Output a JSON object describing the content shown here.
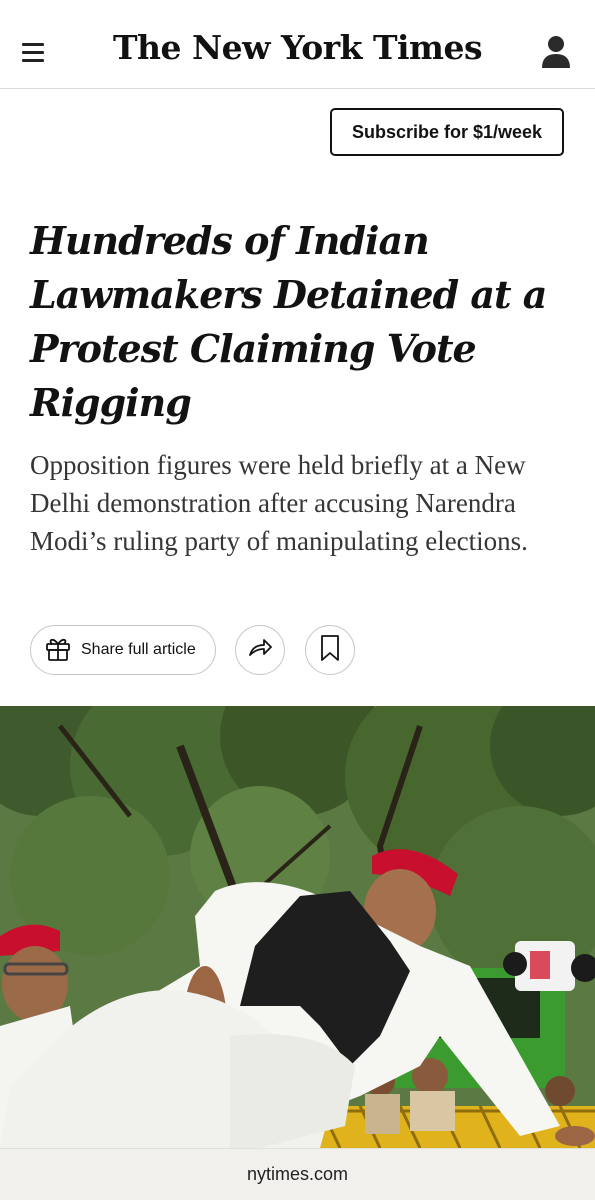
{
  "header": {
    "logo": "The New York Times",
    "menu_icon": "hamburger-menu-icon",
    "account_icon": "person-icon"
  },
  "subscribe": {
    "label": "Subscribe for $1/week"
  },
  "article": {
    "headline": "Hundreds of Indian Lawmakers Detained at a Protest Claiming Vote Rigging",
    "summary": "Opposition figures were held briefly at a New Delhi demonstration after accusing Narendra Modi’s ruling party of manipulating elections."
  },
  "actions": {
    "share_full_label": "Share full article",
    "gift_icon": "gift-icon",
    "share_icon": "share-arrow-icon",
    "bookmark_icon": "bookmark-icon"
  },
  "photo": {
    "kind": "news-photo"
  },
  "browser": {
    "domain": "nytimes.com"
  },
  "colors": {
    "text": "#121212",
    "summary": "#363636",
    "border": "#c7c7c7",
    "urlbar": "#f2f0ec",
    "cap_red": "#c8102e"
  }
}
